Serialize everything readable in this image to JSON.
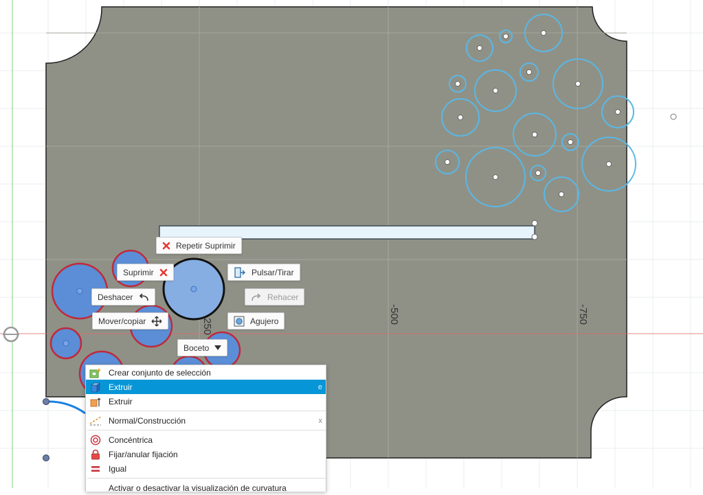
{
  "canvas": {
    "axis_labels": [
      "-250",
      "-500",
      "-750"
    ],
    "colors": {
      "background": "#ffffff",
      "grid_line": "#e8ecef",
      "plate_fill": "#8f9187",
      "plate_outline": "#1f1f1f",
      "sketch_circle": "#5ab8e6",
      "selected_fill": "#5b8ed6",
      "selected_outline": "#c0293b",
      "x_axis": "#e06666",
      "y_axis": "#7cd67c",
      "slot_fill": "#e7f4fb"
    }
  },
  "marking_menu": {
    "repeat_delete": "Repetir Suprimir",
    "delete": "Suprimir",
    "press_pull": "Pulsar/Tirar",
    "undo": "Deshacer",
    "redo": "Rehacer",
    "move_copy": "Mover/copiar",
    "hole": "Agujero",
    "sketch": "Boceto"
  },
  "context_menu": {
    "items": [
      {
        "label": "Crear conjunto de selección",
        "icon": "selection-set-icon",
        "shortcut": ""
      },
      {
        "label": "Extruir",
        "icon": "extrude-sketch-icon",
        "shortcut": "e",
        "selected": true
      },
      {
        "label": "Extruir",
        "icon": "extrude-body-icon",
        "shortcut": ""
      },
      {
        "label": "Normal/Construcción",
        "icon": "construction-line-icon",
        "shortcut": "x"
      },
      {
        "label": "Concéntrica",
        "icon": "concentric-icon",
        "shortcut": ""
      },
      {
        "label": "Fijar/anular fijación",
        "icon": "lock-icon",
        "shortcut": ""
      },
      {
        "label": "Igual",
        "icon": "equal-icon",
        "shortcut": ""
      },
      {
        "label": "Activar o desactivar la visualización de curvatura",
        "icon": "curvature-icon",
        "shortcut": ""
      }
    ]
  }
}
